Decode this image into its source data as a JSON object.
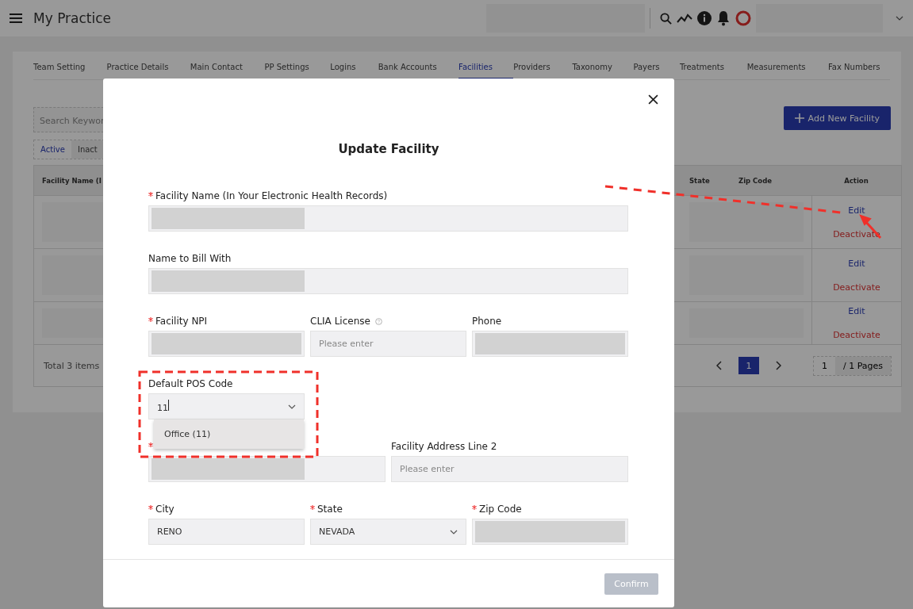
{
  "header": {
    "title": "My Practice"
  },
  "tabs": [
    {
      "label": "Team Setting",
      "selected": false
    },
    {
      "label": "Practice Details",
      "selected": false
    },
    {
      "label": "Main Contact",
      "selected": false
    },
    {
      "label": "PP Settings",
      "selected": false
    },
    {
      "label": "Logins",
      "selected": false
    },
    {
      "label": "Bank Accounts",
      "selected": false
    },
    {
      "label": "Facilities",
      "selected": true
    },
    {
      "label": "Providers",
      "selected": false
    },
    {
      "label": "Taxonomy",
      "selected": false
    },
    {
      "label": "Payers",
      "selected": false
    },
    {
      "label": "Treatments",
      "selected": false
    },
    {
      "label": "Measurements",
      "selected": false
    },
    {
      "label": "Fax Numbers",
      "selected": false
    }
  ],
  "toolbar": {
    "search_placeholder": "Search Keywor",
    "add_button": "Add New Facility"
  },
  "status_tabs": [
    {
      "label": "Active",
      "selected": true
    },
    {
      "label": "Inact",
      "selected": false
    }
  ],
  "table": {
    "columns": [
      "Facility Name (I",
      "State",
      "Zip Code",
      "Action"
    ],
    "rows": [
      {
        "actions": [
          "Edit",
          "Deactivate"
        ]
      },
      {
        "actions": [
          "Edit",
          "Deactivate"
        ]
      },
      {
        "actions": [
          "Edit",
          "Deactivate"
        ]
      }
    ]
  },
  "pagination": {
    "total": "Total 3 items",
    "pages": [
      {
        "label": "1",
        "selected": true
      }
    ],
    "jump_value": "1",
    "page_count": "/ 1 Pages"
  },
  "modal": {
    "title": "Update Facility",
    "rows": [
      [
        {
          "label": "Facility Name (In Your Electronic Health Records)",
          "required": true,
          "kind": "partmasked"
        }
      ],
      [
        {
          "label": "Name to Bill With",
          "required": false,
          "kind": "partmasked"
        }
      ],
      [
        {
          "label": "Facility NPI",
          "required": true,
          "kind": "masked"
        },
        {
          "label": "CLIA License",
          "required": false,
          "kind": "text",
          "placeholder": "Please enter",
          "help": true
        },
        {
          "label": "Phone",
          "required": false,
          "kind": "masked"
        }
      ],
      [
        {
          "label": "Default POS Code",
          "required": false,
          "kind": "combo",
          "value": "11",
          "options": [
            {
              "label": "Office (11)",
              "selected": false
            }
          ]
        }
      ],
      [
        {
          "required": true,
          "kind": "partmasked"
        },
        {
          "label": "Facility Address Line 2",
          "required": false,
          "kind": "text",
          "placeholder": "Please enter"
        }
      ],
      [
        {
          "label": "City",
          "required": true,
          "kind": "text",
          "value": "RENO"
        },
        {
          "label": "State",
          "required": true,
          "kind": "select",
          "value": "NEVADA"
        },
        {
          "label": "Zip Code",
          "required": true,
          "kind": "masked"
        }
      ]
    ],
    "confirm": {
      "label": "Confirm",
      "disabled": true
    }
  }
}
